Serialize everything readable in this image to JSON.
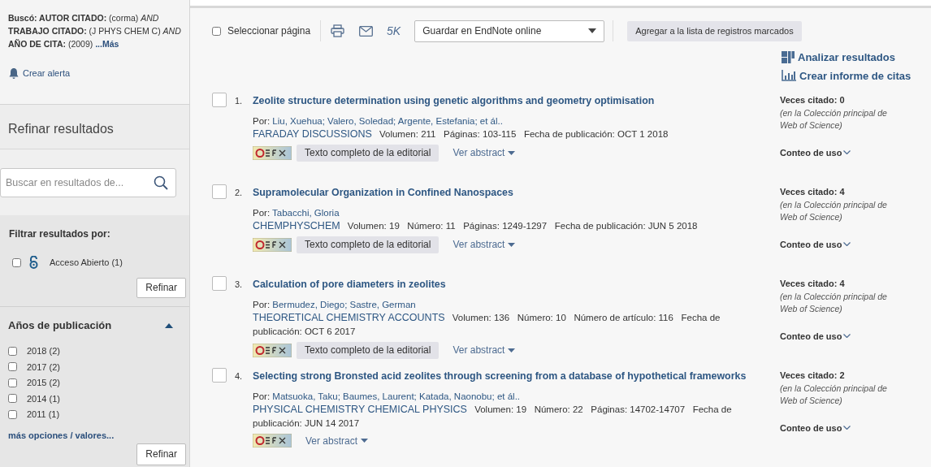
{
  "sidebar": {
    "query": "**Buscó: AUTOR CITADO:** (corma) *AND* **TRABAJO CITADO:** (J PHYS CHEM C) *AND* **AÑO DE CITA:** (2009)",
    "more_link": "...Más",
    "alert": "Crear alerta",
    "refine_title": "Refinar resultados",
    "search": {
      "placeholder": "Buscar en resultados de..."
    },
    "filter_title": "Filtrar resultados por:",
    "filters": [
      {
        "label": "Acceso Abierto (1)",
        "checked": false
      }
    ],
    "refine_button": "Refinar",
    "years_title": "Años de publicación",
    "years_expanded": true,
    "years": [
      {
        "label": "2018 (2)",
        "checked": false
      },
      {
        "label": "2017 (2)",
        "checked": false
      },
      {
        "label": "2015 (2)",
        "checked": false
      },
      {
        "label": "2014 (1)",
        "checked": false
      },
      {
        "label": "2011 (1)",
        "checked": false
      }
    ],
    "more_options": "más opciones / valores...",
    "years_refine_button": "Refinar"
  },
  "toolbar": {
    "select_page": {
      "label": "Seleccionar página",
      "checked": false
    },
    "export_count": "5K",
    "save_select": "Guardar en EndNote online",
    "add_button": "Agregar a la lista de registros marcados"
  },
  "actions": [
    "Analizar resultados",
    "Crear informe de citas"
  ],
  "records": [
    {
      "number": "1.",
      "selected": false,
      "title": "Zeolite structure determination using genetic algorithms and geometry optimisation",
      "by_label": "Por:",
      "authors": "Liu, Xuehua; Valero, Soledad; Argente, Estefania; et ál..",
      "source": "FARADAY DISCUSSIONS",
      "fields": [
        {
          "label": "Volumen:",
          "value": "211"
        },
        {
          "label": "Páginas:",
          "value": "103-115"
        },
        {
          "label": "Fecha de publicación:",
          "value": "OCT 1 2018"
        }
      ],
      "full_text": "Texto completo de la editorial",
      "abstract": "Ver abstract",
      "cited": "Veces citado:",
      "cited_count": "0",
      "collection": "(en la Colección principal de Web of Science)",
      "usage": "Conteo de uso"
    },
    {
      "number": "2.",
      "selected": false,
      "title": "Supramolecular Organization in Confined Nanospaces",
      "by_label": "Por:",
      "authors": "Tabacchi, Gloria",
      "source": "CHEMPHYSCHEM",
      "fields": [
        {
          "label": "Volumen:",
          "value": "19"
        },
        {
          "label": "Número:",
          "value": "11"
        },
        {
          "label": "Páginas:",
          "value": "1249-1297"
        },
        {
          "label": "Fecha de publicación:",
          "value": "JUN 5 2018"
        }
      ],
      "full_text": "Texto completo de la editorial",
      "abstract": "Ver abstract",
      "cited": "Veces citado:",
      "cited_count": "4",
      "collection": "(en la Colección principal de Web of Science)",
      "usage": "Conteo de uso"
    },
    {
      "number": "3.",
      "selected": false,
      "title": "Calculation of pore diameters in zeolites",
      "by_label": "Por:",
      "authors": "Bermudez, Diego; Sastre, German",
      "source": "THEORETICAL CHEMISTRY ACCOUNTS",
      "fields": [
        {
          "label": "Volumen:",
          "value": "136"
        },
        {
          "label": "Número:",
          "value": "10"
        },
        {
          "label": "Número de artículo:",
          "value": "116"
        },
        {
          "label": "Fecha de publicación:",
          "value": "OCT 6 2017"
        }
      ],
      "full_text": "Texto completo de la editorial",
      "abstract": "Ver abstract",
      "cited": "Veces citado:",
      "cited_count": "4",
      "collection": "(en la Colección principal de Web of Science)",
      "usage": "Conteo de uso"
    },
    {
      "number": "4.",
      "selected": false,
      "title": "Selecting strong Bronsted acid zeolites through screening from a database of hypothetical frameworks",
      "by_label": "Por:",
      "authors": "Matsuoka, Taku; Baumes, Laurent; Katada, Naonobu; et ál..",
      "source": "PHYSICAL CHEMISTRY CHEMICAL PHYSICS",
      "fields": [
        {
          "label": "Volumen:",
          "value": "19"
        },
        {
          "label": "Número:",
          "value": "22"
        },
        {
          "label": "Páginas:",
          "value": "14702-14707"
        },
        {
          "label": "Fecha de publicación:",
          "value": "JUN 14 2017"
        }
      ],
      "abstract": "Ver abstract",
      "cited": "Veces citado:",
      "cited_count": "2",
      "collection": "(en la Colección principal de Web of Science)",
      "usage": "Conteo de uso"
    }
  ]
}
